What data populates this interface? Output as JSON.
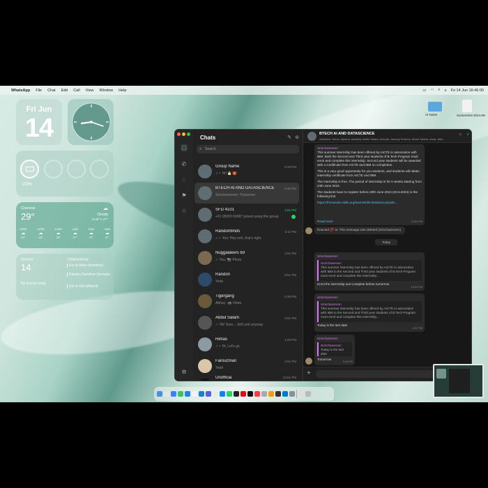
{
  "menubar": {
    "app_name": "WhatsApp",
    "menus": [
      "File",
      "Chat",
      "Edit",
      "Call",
      "View",
      "Window",
      "Help"
    ],
    "clock": "Fri 14 Jun 16:46:00"
  },
  "widgets": {
    "date": {
      "weekday": "Fri Jun",
      "day": "14"
    },
    "battery": {
      "percent": "100%"
    },
    "weather": {
      "city": "Chennai",
      "temp": "29°",
      "condition": "Cloudy",
      "hilo": "H:33° L:27°",
      "hours": [
        "10PM",
        "11PM",
        "12AM",
        "1AM",
        "2AM",
        "3AM"
      ],
      "temps": [
        "29°",
        "28°",
        "28°",
        "27°",
        "27°",
        "27°"
      ]
    },
    "calendar": {
      "weekday": "FRIDAY",
      "day": "14",
      "no_events": "No events today",
      "tomorrow": "TOMORROW",
      "events": [
        "Eid al-Adha (tentative)",
        "Raksha Bandhan (tentative)"
      ],
      "more": "Eid al-Adha/Bakrid"
    }
  },
  "sidebar": {
    "title": "Chats",
    "search_placeholder": "Search",
    "chats": [
      {
        "name": "Group Name",
        "preview": "✓✓ Hi! 🎂 🎁",
        "time": "5:28 PM"
      },
      {
        "name": "BTECH AI AND DATASCIENCE",
        "preview": "Srinchamenen: Tomorrow",
        "time": "5:49 PM"
      },
      {
        "name": "SFD 4101",
        "preview": "+91 95000 69087 joined using this group",
        "time": "4:51 PM"
      },
      {
        "name": "Randomfinds",
        "preview": "✓✓ You: Hey ooh, that's right",
        "time": "3:11 PM"
      },
      {
        "name": "Nuggalakers 69",
        "preview": "✓ You: 📷 Photo",
        "time": "2:51 PM"
      },
      {
        "name": "Randon",
        "preview": "Yeah",
        "time": "6:51 PM"
      },
      {
        "name": "Tigergang",
        "preview": "Abhay: 📹 Video",
        "time": "5:35 PM"
      },
      {
        "name": "Abdul Salam",
        "preview": "✓ Ok! Sure... Still cant anyway",
        "time": "4:51 PM"
      },
      {
        "name": "Himas",
        "preview": "✓✓ Hi, Let's go",
        "time": "4:29 PM"
      },
      {
        "name": "Farouzman",
        "preview": "Yeah",
        "time": "2:51 PM"
      },
      {
        "name": "Unofficia",
        "preview": "Tomorrow always waste after but whatsoever",
        "time": "12:51 PM"
      }
    ]
  },
  "chat": {
    "title": "BTECH AI AND DATASCIENCE",
    "members": "Abhishek Jeeva, Ajantha, Aashika, Abdul Salam, Anirudh, Akshay Pramod, Abdul Jabbar, Amal, Abhi...",
    "msg1": {
      "author": "Srinchamenen",
      "body1": "This summer internship has been offered by AICTE in association with IBM. Both the Second and Third year students of B.Tech Program must enrol and complete this internship. Second year students will be awarded with a Certificate from AICTE and IBM on completion.",
      "body2": "This is a very good opportunity for you students, and students will obtain internship certificate from AICTE and IBM.",
      "body3": "The internship is free. The period of internship is for 5 weeks starting from 24th June 2024.",
      "body4": "The students have to register before 20th June 2024 (20.6.2024) in the following link.",
      "link": "https://threesixtiv.skills.org/learn/skills-details/ai-phyiais...",
      "read_more": "Read more",
      "time": "12:51 PM"
    },
    "deleted_note": "Reacted 💯 to: This message was deleted (Srinchamenen)",
    "day_divider": "Today",
    "msg2": {
      "author": "Srinchamenen",
      "quote_author": "Srinchamenen",
      "quote": "This summer internship has been offered by AICTE in association with IBM to the Second and Third year students of B.Tech Program must enrol and complete this internship...",
      "body": "Enrol the internship and complete before tomorrow",
      "time": "12:51 PM"
    },
    "msg3": {
      "author": "Srinchamenen",
      "quote_author": "Srinchamenen",
      "quote": "This summer internship has been offered by AICTE in association with IBM to the Second and Third year students of B.Tech Program must enrol and complete this internship...",
      "body": "Today is the last date",
      "time": "4:37 PM"
    },
    "msg4": {
      "author": "Srinchamenen",
      "quote_author": "Srinchamenen",
      "quote": "Today is the last date",
      "body": "Tomorrow",
      "time": "5:49 PM"
    }
  },
  "desktop": {
    "folder_label": "AI Notes",
    "file_label": "Screenshot 2024-06-14 at 4.46.00 PM"
  }
}
